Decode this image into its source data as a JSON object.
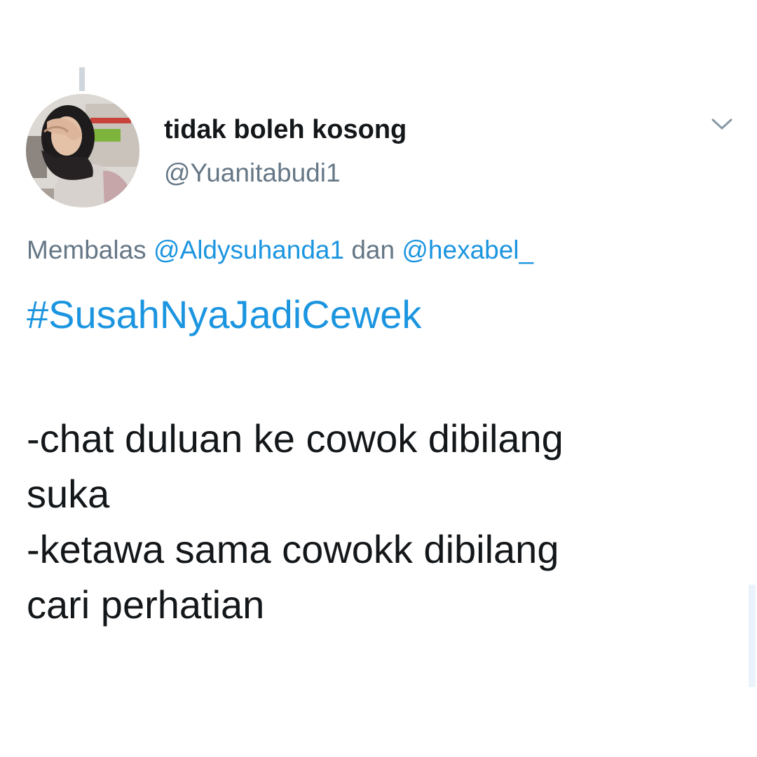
{
  "tweet": {
    "display_name": "tidak boleh kosong",
    "handle": "@Yuanitabudi1",
    "reply_prefix": "Membalas",
    "reply_to": [
      "@Aldysuhanda1",
      "@hexabel_"
    ],
    "reply_joiner": "dan",
    "hashtag": "#SusahNyaJadiCewek",
    "lines": [
      "-chat duluan ke cowok dibilang",
      "suka",
      "-ketawa sama cowokk dibilang",
      "cari perhatian"
    ]
  },
  "icons": {
    "menu": "chevron-down-icon"
  },
  "colors": {
    "link": "#1b95e0",
    "secondary_text": "#657786",
    "primary_text": "#14171a"
  }
}
